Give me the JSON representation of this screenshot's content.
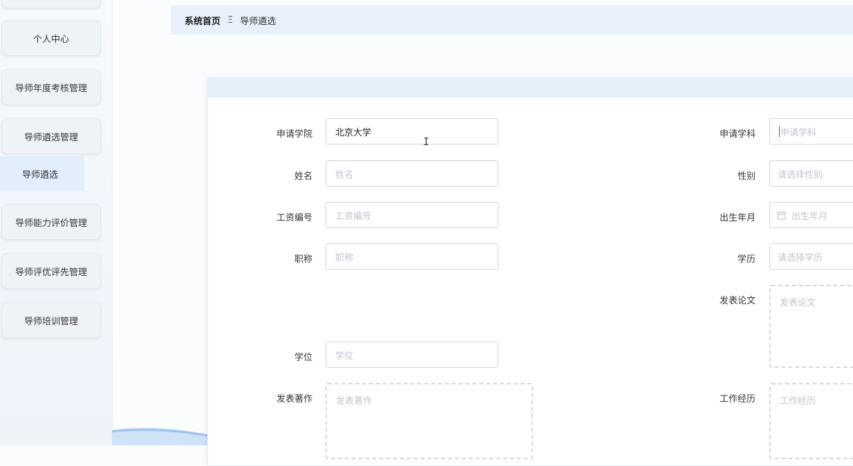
{
  "sidebar": {
    "items": [
      {
        "label": ""
      },
      {
        "label": "个人中心"
      },
      {
        "label": "导师年度考核管理"
      },
      {
        "label": "导师遴选管理"
      },
      {
        "label": "导师能力评价管理"
      },
      {
        "label": "导师评优评先管理"
      },
      {
        "label": "导师培训管理"
      }
    ],
    "sub_item": "导师遴选"
  },
  "breadcrumb": {
    "home": "系统首页",
    "separator": "Ξ",
    "current": "导师遴选"
  },
  "form": {
    "left": [
      {
        "label": "申请学院",
        "value": "北京大学",
        "placeholder": ""
      },
      {
        "label": "姓名",
        "value": "",
        "placeholder": "姓名"
      },
      {
        "label": "工资编号",
        "value": "",
        "placeholder": "工资编号"
      },
      {
        "label": "职称",
        "value": "",
        "placeholder": "职称"
      },
      {
        "label": "学位",
        "value": "",
        "placeholder": "学位"
      },
      {
        "label": "发表著作",
        "value": "",
        "placeholder": "发表著作"
      }
    ],
    "right": [
      {
        "label": "申请学科",
        "value": "",
        "placeholder": "申请学科"
      },
      {
        "label": "性别",
        "value": "",
        "placeholder": "请选择性别"
      },
      {
        "label": "出生年月",
        "value": "",
        "placeholder": "出生年月"
      },
      {
        "label": "学历",
        "value": "",
        "placeholder": "请选择学历"
      },
      {
        "label": "发表论文",
        "value": "",
        "placeholder": "发表论文"
      },
      {
        "label": "工作经历",
        "value": "",
        "placeholder": "工作经历"
      }
    ]
  },
  "icons": {
    "calendar": "calendar-icon",
    "cursor": "text-cursor-icon"
  },
  "colors": {
    "accent_bg": "#e8f1fb",
    "sub_item_bg": "#e3eefb",
    "placeholder": "#c0c4cc"
  }
}
